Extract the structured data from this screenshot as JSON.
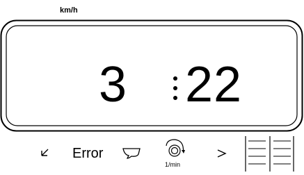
{
  "display": {
    "unit": "km/h",
    "value_left": "3",
    "value_right": "22"
  },
  "status_bar": {
    "error_label": "Error",
    "rpm_unit": "1/min",
    "icons": [
      "chevron-left-icon",
      "tray-icon",
      "rotation-sensor-icon",
      "chevron-right-icon",
      "grid-icon"
    ]
  }
}
